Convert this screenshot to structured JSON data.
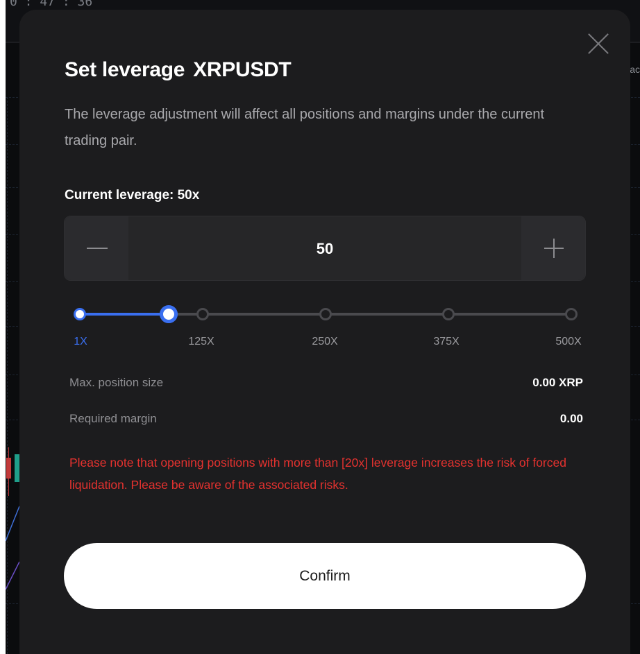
{
  "background": {
    "clock_text": "0 : 47 : 36",
    "right_edge_text": "ac"
  },
  "modal": {
    "title": "Set leverage",
    "pair": "XRPUSDT",
    "description": "The leverage adjustment will affect all positions and margins under the current trading pair.",
    "current_leverage_label": "Current leverage: 50x",
    "stepper": {
      "value": "50",
      "minus_icon": "minus-icon",
      "plus_icon": "plus-icon"
    },
    "slider": {
      "min": 1,
      "max": 500,
      "value": 50,
      "ticks": [
        "1X",
        "125X",
        "250X",
        "375X",
        "500X"
      ],
      "accent_color": "#3a6ff0"
    },
    "info": {
      "max_position_label": "Max. position size",
      "max_position_value": "0.00 XRP",
      "required_margin_label": "Required margin",
      "required_margin_value": "0.00"
    },
    "warning": "Please note that opening positions with more than [20x] leverage increases the risk of forced liquidation. Please be aware of the associated risks.",
    "warning_color": "#e5322f",
    "confirm_label": "Confirm"
  }
}
